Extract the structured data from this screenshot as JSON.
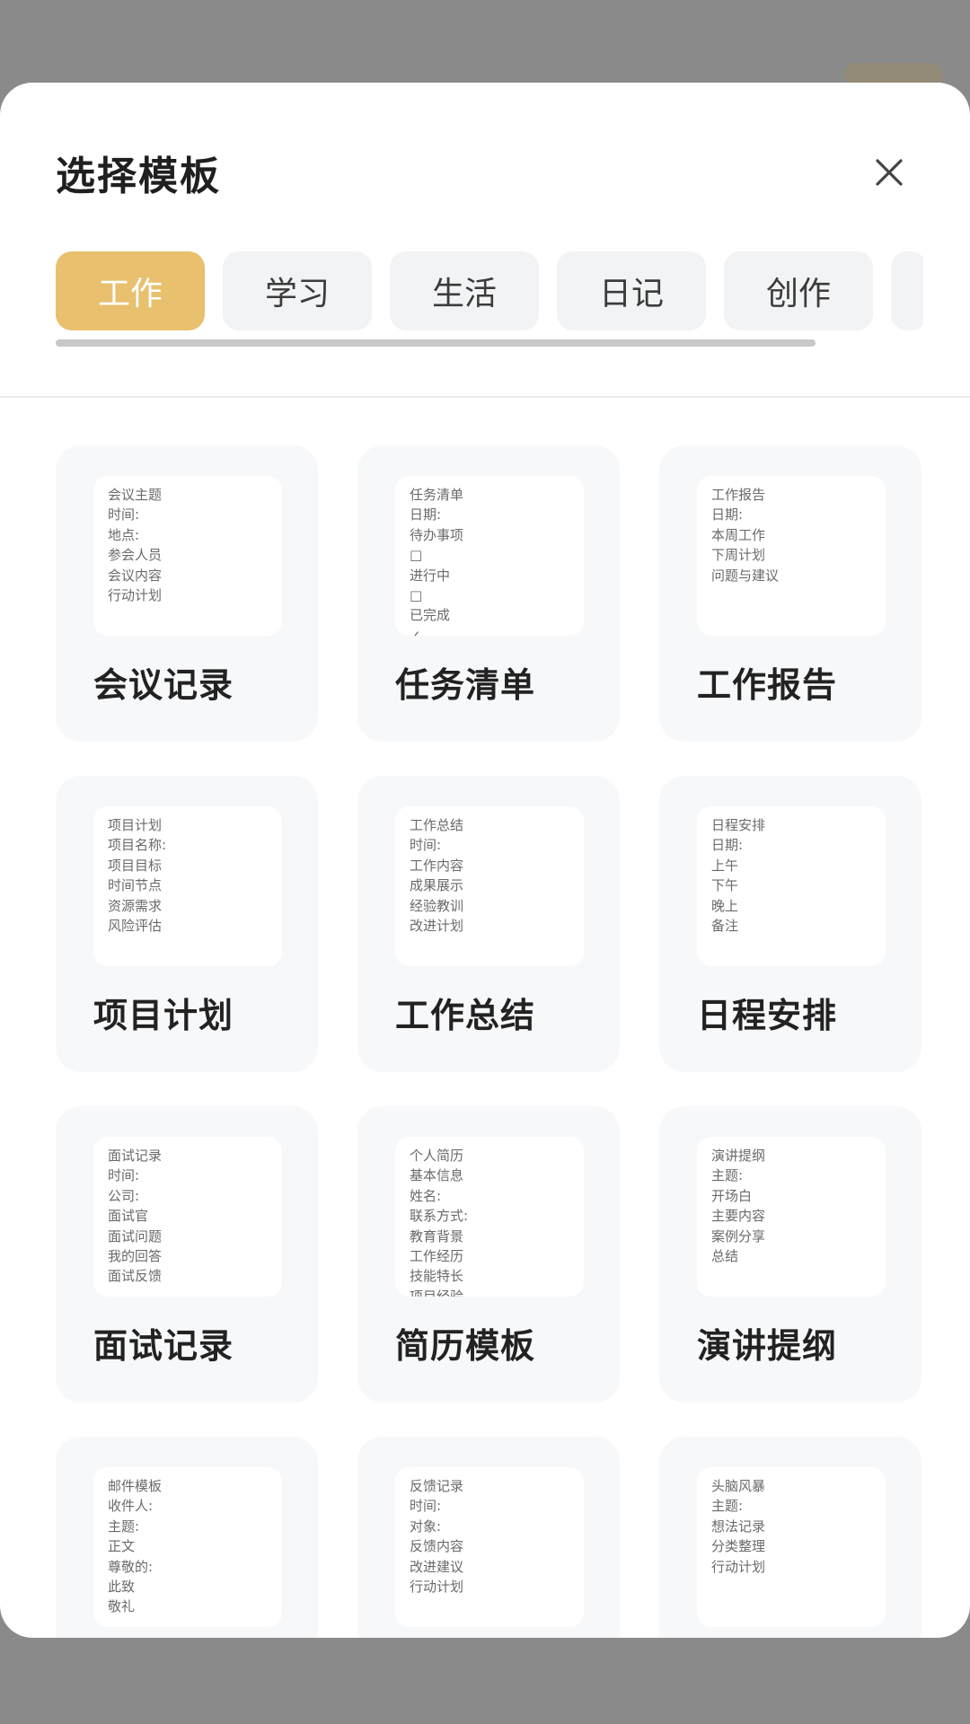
{
  "modal": {
    "title": "选择模板",
    "close_icon": "close-icon"
  },
  "tabs": [
    {
      "label": "工作",
      "active": true
    },
    {
      "label": "学习",
      "active": false
    },
    {
      "label": "生活",
      "active": false
    },
    {
      "label": "日记",
      "active": false
    },
    {
      "label": "创作",
      "active": false
    }
  ],
  "templates": [
    {
      "title": "会议记录",
      "preview": [
        "会议主题",
        "时间:",
        "地点:",
        "参会人员",
        "会议内容",
        "行动计划"
      ]
    },
    {
      "title": "任务清单",
      "preview": [
        "任务清单",
        "日期:",
        "待办事项",
        "□",
        "进行中",
        "□",
        "已完成",
        "✓"
      ]
    },
    {
      "title": "工作报告",
      "preview": [
        "工作报告",
        "日期:",
        "本周工作",
        "下周计划",
        "问题与建议"
      ]
    },
    {
      "title": "项目计划",
      "preview": [
        "项目计划",
        "项目名称:",
        "项目目标",
        "时间节点",
        "资源需求",
        "风险评估"
      ]
    },
    {
      "title": "工作总结",
      "preview": [
        "工作总结",
        "时间:",
        "工作内容",
        "成果展示",
        "经验教训",
        "改进计划"
      ]
    },
    {
      "title": "日程安排",
      "preview": [
        "日程安排",
        "日期:",
        "上午",
        "下午",
        "晚上",
        "备注"
      ]
    },
    {
      "title": "面试记录",
      "preview": [
        "面试记录",
        "时间:",
        "公司:",
        "面试官",
        "面试问题",
        "我的回答",
        "面试反馈"
      ]
    },
    {
      "title": "简历模板",
      "preview": [
        "个人简历",
        "基本信息",
        "姓名:",
        "联系方式:",
        "教育背景",
        "工作经历",
        "技能特长",
        "项目经验"
      ]
    },
    {
      "title": "演讲提纲",
      "preview": [
        "演讲提纲",
        "主题:",
        "开场白",
        "主要内容",
        "案例分享",
        "总结"
      ]
    },
    {
      "title": "",
      "preview": [
        "邮件模板",
        "收件人:",
        "主题:",
        "正文",
        "尊敬的:",
        "此致",
        "敬礼"
      ]
    },
    {
      "title": "",
      "preview": [
        "反馈记录",
        "时间:",
        "对象:",
        "反馈内容",
        "改进建议",
        "行动计划"
      ]
    },
    {
      "title": "",
      "preview": [
        "头脑风暴",
        "主题:",
        "想法记录",
        "分类整理",
        "行动计划"
      ]
    }
  ]
}
